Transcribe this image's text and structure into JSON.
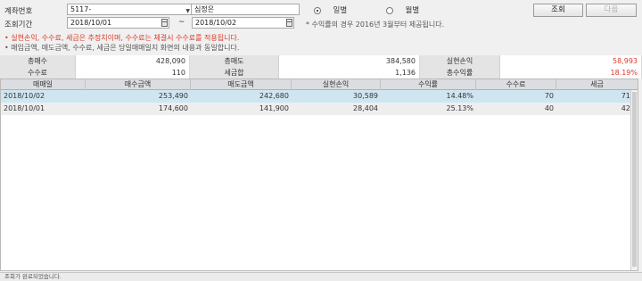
{
  "form": {
    "account_label": "계좌번호",
    "account_value": "5117-",
    "account_name": "심정은",
    "period_label": "조회기간",
    "date_from": "2018/10/01",
    "date_sep": "~",
    "date_to": "2018/10/02",
    "radio_daily": "일별",
    "radio_monthly": "월별",
    "search_button": "조회",
    "next_button": "다음",
    "return_note": "* 수익률의 경우 2016년 3월부터 제공됩니다.",
    "note_red": "• 실현손익, 수수료, 세금은 추정치이며, 수수료는 체결시 수수료를 적용됩니다.",
    "note_gray": "• 매입금액, 매도금액, 수수료, 세금은 당일매매일지 화면의 내용과 동일합니다."
  },
  "summary": {
    "row1": [
      {
        "label": "총매수",
        "value": "428,090"
      },
      {
        "label": "총매도",
        "value": "384,580"
      },
      {
        "label": "실현손익",
        "value": "58,993"
      }
    ],
    "row2": [
      {
        "label": "수수료",
        "value": "110"
      },
      {
        "label": "세금합",
        "value": "1,136"
      },
      {
        "label": "총수익률",
        "value": "18.19%"
      }
    ]
  },
  "grid": {
    "columns": [
      "매매일",
      "매수금액",
      "매도금액",
      "실현손익",
      "수익률",
      "수수료",
      "세금"
    ],
    "rows": [
      [
        "2018/10/02",
        "253,490",
        "242,680",
        "30,589",
        "14.48%",
        "70",
        "715"
      ],
      [
        "2018/10/01",
        "174,600",
        "141,900",
        "28,404",
        "25.13%",
        "40",
        "421"
      ]
    ]
  },
  "status": {
    "text": "조회가 완료되었습니다."
  },
  "colors": {
    "accent_red": "#d93a2b",
    "selected_row": "#cfe6f1"
  }
}
